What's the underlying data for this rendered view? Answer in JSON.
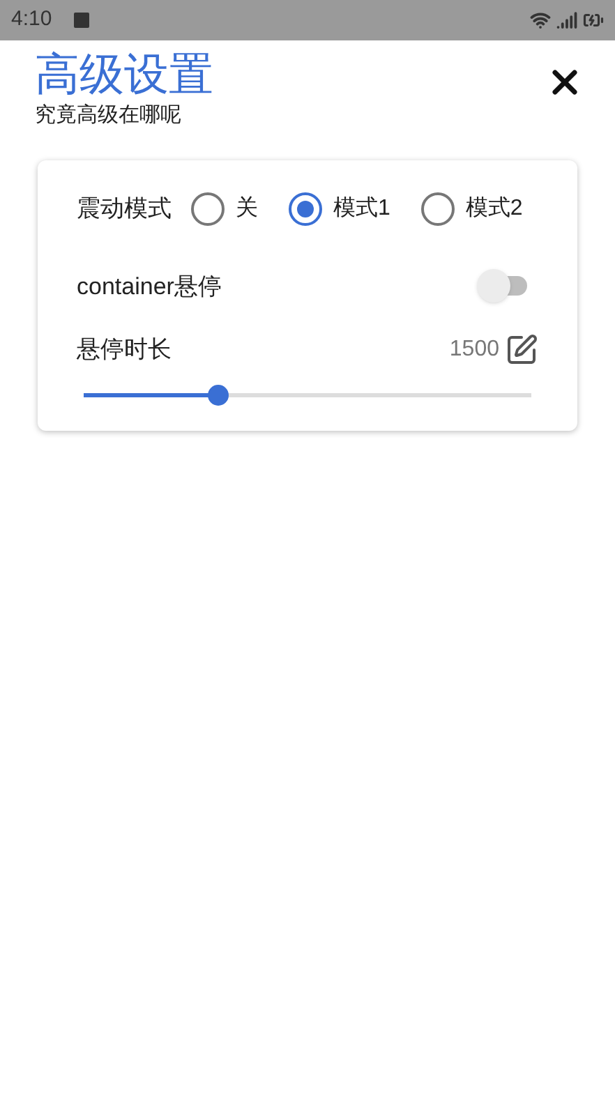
{
  "status_bar": {
    "time": "4:10"
  },
  "header": {
    "title": "高级设置",
    "subtitle": "究竟高级在哪呢"
  },
  "settings": {
    "vibration": {
      "label": "震动模式",
      "options": [
        {
          "label": "关",
          "selected": false
        },
        {
          "label": "模式1",
          "selected": true
        },
        {
          "label": "模式2",
          "selected": false
        }
      ]
    },
    "hover": {
      "label": "container悬停",
      "on": false
    },
    "duration": {
      "label": "悬停时长",
      "value": "1500",
      "level": 0.3
    }
  }
}
